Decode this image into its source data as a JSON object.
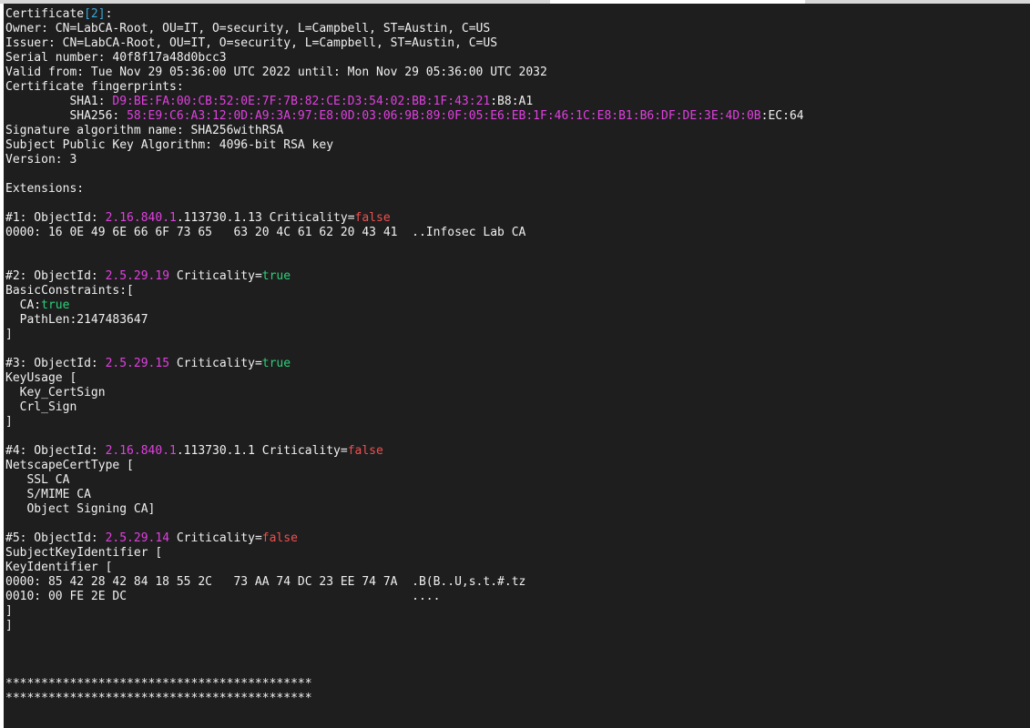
{
  "terminal": {
    "lines": [
      [
        [
          "Certificate",
          "white"
        ],
        [
          "[2]",
          "cyan"
        ],
        [
          ":",
          "white"
        ]
      ],
      [
        [
          "Owner: CN=LabCA-Root, OU=IT, O=security, L=Campbell, ST=Austin, C=US",
          "white"
        ]
      ],
      [
        [
          "Issuer: CN=LabCA-Root, OU=IT, O=security, L=Campbell, ST=Austin, C=US",
          "white"
        ]
      ],
      [
        [
          "Serial number: 40f8f17a48d0bcc3",
          "white"
        ]
      ],
      [
        [
          "Valid from: Tue Nov 29 05:36:00 UTC 2022 until: Mon Nov 29 05:36:00 UTC 2032",
          "white"
        ]
      ],
      [
        [
          "Certificate fingerprints:",
          "white"
        ]
      ],
      [
        [
          "         SHA1: ",
          "white"
        ],
        [
          "D9:BE:FA:00:CB:52:0E:7F:7B:82:CE:D3:54:02:BB:1F:43:21",
          "magenta"
        ],
        [
          ":B8:A1",
          "white"
        ]
      ],
      [
        [
          "         SHA256: ",
          "white"
        ],
        [
          "58:E9:C6:A3:12:0D:A9:3A:97:E8:0D:03:06:9B:89:0F:05:E6:EB:1F:46:1C:E8:B1:B6:DF:DE:3E:4D:0B",
          "magenta"
        ],
        [
          ":EC:64",
          "white"
        ]
      ],
      [
        [
          "Signature algorithm name: SHA256withRSA",
          "white"
        ]
      ],
      [
        [
          "Subject Public Key Algorithm: 4096-bit RSA key",
          "white"
        ]
      ],
      [
        [
          "Version: 3",
          "white"
        ]
      ],
      [
        [
          "",
          "white"
        ]
      ],
      [
        [
          "Extensions:",
          "white"
        ]
      ],
      [
        [
          "",
          "white"
        ]
      ],
      [
        [
          "#1: ObjectId: ",
          "white"
        ],
        [
          "2.16.840.1",
          "magenta"
        ],
        [
          ".113730.1.13 Criticality=",
          "white"
        ],
        [
          "false",
          "red"
        ]
      ],
      [
        [
          "0000: 16 0E 49 6E 66 6F 73 65   63 20 4C 61 62 20 43 41  ..Infosec Lab CA",
          "white"
        ]
      ],
      [
        [
          "",
          "white"
        ]
      ],
      [
        [
          "",
          "white"
        ]
      ],
      [
        [
          "#2: ObjectId: ",
          "white"
        ],
        [
          "2.5.29.19",
          "magenta"
        ],
        [
          " Criticality=",
          "white"
        ],
        [
          "true",
          "green"
        ]
      ],
      [
        [
          "BasicConstraints:[",
          "white"
        ]
      ],
      [
        [
          "  CA:",
          "white"
        ],
        [
          "true",
          "green"
        ]
      ],
      [
        [
          "  PathLen:2147483647",
          "white"
        ]
      ],
      [
        [
          "]",
          "white"
        ]
      ],
      [
        [
          "",
          "white"
        ]
      ],
      [
        [
          "#3: ObjectId: ",
          "white"
        ],
        [
          "2.5.29.15",
          "magenta"
        ],
        [
          " Criticality=",
          "white"
        ],
        [
          "true",
          "green"
        ]
      ],
      [
        [
          "KeyUsage [",
          "white"
        ]
      ],
      [
        [
          "  Key_CertSign",
          "white"
        ]
      ],
      [
        [
          "  Crl_Sign",
          "white"
        ]
      ],
      [
        [
          "]",
          "white"
        ]
      ],
      [
        [
          "",
          "white"
        ]
      ],
      [
        [
          "#4: ObjectId: ",
          "white"
        ],
        [
          "2.16.840.1",
          "magenta"
        ],
        [
          ".113730.1.1 Criticality=",
          "white"
        ],
        [
          "false",
          "red"
        ]
      ],
      [
        [
          "NetscapeCertType [",
          "white"
        ]
      ],
      [
        [
          "   SSL CA",
          "white"
        ]
      ],
      [
        [
          "   S/MIME CA",
          "white"
        ]
      ],
      [
        [
          "   Object Signing CA]",
          "white"
        ]
      ],
      [
        [
          "",
          "white"
        ]
      ],
      [
        [
          "#5: ObjectId: ",
          "white"
        ],
        [
          "2.5.29.14",
          "magenta"
        ],
        [
          " Criticality=",
          "white"
        ],
        [
          "false",
          "red"
        ]
      ],
      [
        [
          "SubjectKeyIdentifier [",
          "white"
        ]
      ],
      [
        [
          "KeyIdentifier [",
          "white"
        ]
      ],
      [
        [
          "0000: 85 42 28 42 84 18 55 2C   73 AA 74 DC 23 EE 74 7A  .B(B..U,s.t.#.tz",
          "white"
        ]
      ],
      [
        [
          "0010: 00 FE 2E DC                                        ....",
          "white"
        ]
      ],
      [
        [
          "]",
          "white"
        ]
      ],
      [
        [
          "]",
          "white"
        ]
      ],
      [
        [
          "",
          "white"
        ]
      ],
      [
        [
          "",
          "white"
        ]
      ],
      [
        [
          "",
          "white"
        ]
      ],
      [
        [
          "*******************************************",
          "white"
        ]
      ],
      [
        [
          "*******************************************",
          "white"
        ]
      ]
    ]
  },
  "colors": {
    "background": "#1e1e1e",
    "text": "#f0f0f0",
    "magenta": "#e040e0",
    "cyan": "#3aa7d7",
    "green": "#2dd17a",
    "red": "#f05050"
  }
}
